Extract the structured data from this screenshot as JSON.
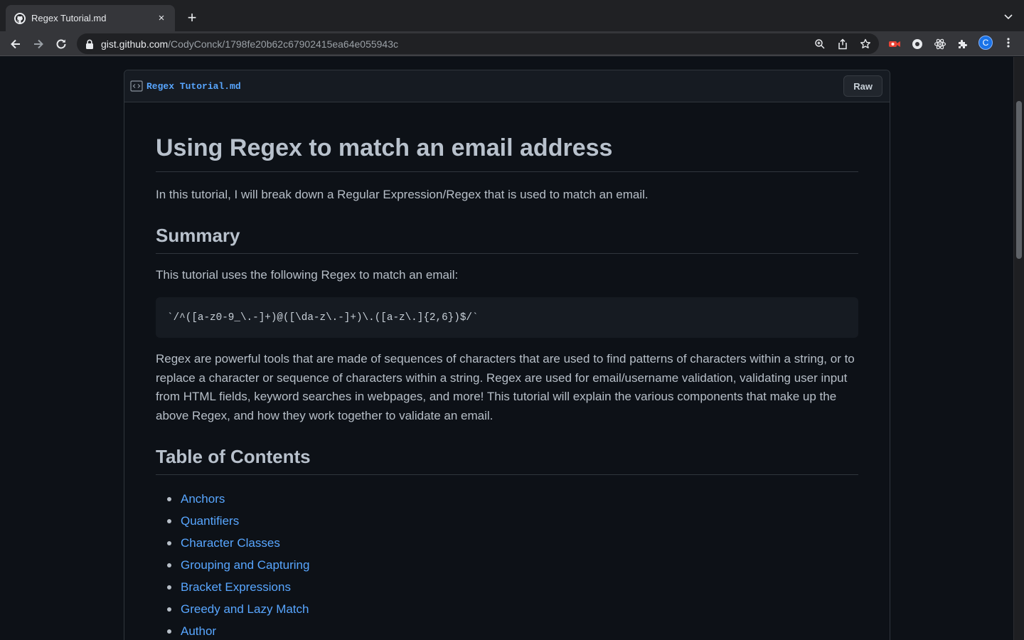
{
  "browser": {
    "tab_title": "Regex Tutorial.md",
    "tab_close": "×",
    "new_tab": "+",
    "url_host": "gist.github.com",
    "url_path": "/CodyConck/1798fe20b62c67902415ea64e055943c",
    "profile_initial": "C"
  },
  "file": {
    "name": "Regex Tutorial.md",
    "raw_label": "Raw"
  },
  "markdown": {
    "h1": "Using Regex to match an email address",
    "intro": "In this tutorial, I will break down a Regular Expression/Regex that is used to match an email.",
    "summary_heading": "Summary",
    "summary_text": "This tutorial uses the following Regex to match an email:",
    "code": "`/^([a-z0-9_\\.-]+)@([\\da-z\\.-]+)\\.([a-z\\.]{2,6})$/`",
    "description": "Regex are powerful tools that are made of sequences of characters that are used to find patterns of characters within a string, or to replace a character or sequence of characters within a string. Regex are used for email/username validation, validating user input from HTML fields, keyword searches in webpages, and more! This tutorial will explain the various components that make up the above Regex, and how they work together to validate an email.",
    "toc_heading": "Table of Contents",
    "toc": [
      "Anchors",
      "Quantifiers",
      "Character Classes",
      "Grouping and Capturing",
      "Bracket Expressions",
      "Greedy and Lazy Match",
      "Author"
    ]
  },
  "colors": {
    "link": "#58a6ff",
    "background": "#0d1117",
    "chrome": "#35363a"
  }
}
